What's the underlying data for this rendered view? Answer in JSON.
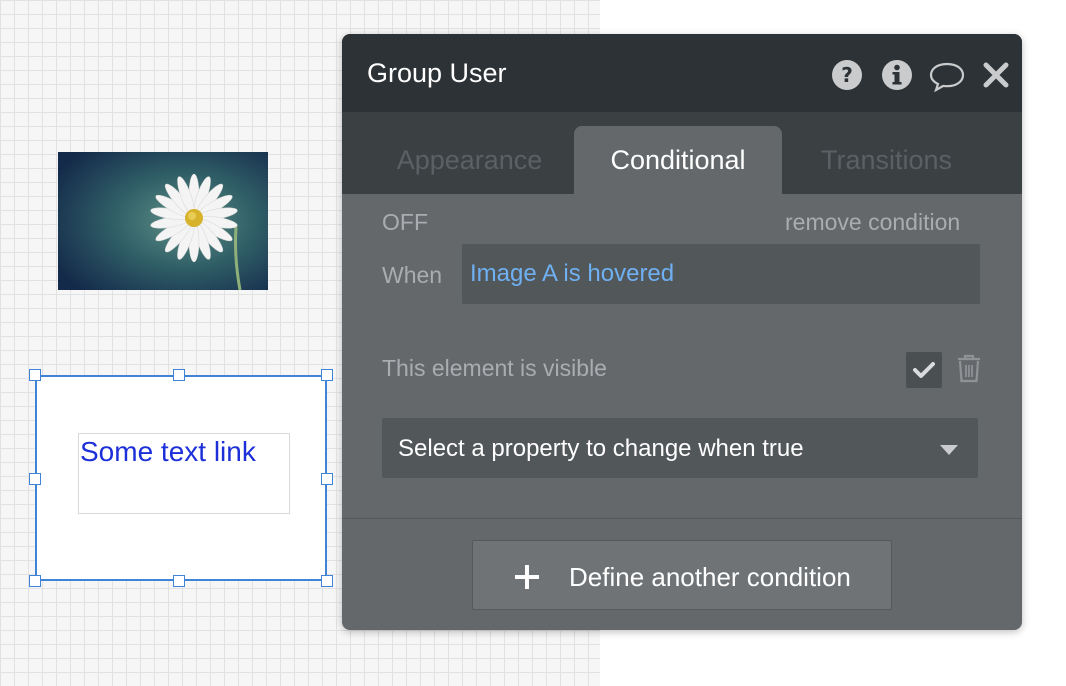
{
  "panel": {
    "title": "Group User",
    "icons": [
      "help-icon",
      "info-icon",
      "comment-icon",
      "close-icon"
    ]
  },
  "tabs": [
    {
      "label": "Appearance",
      "active": false
    },
    {
      "label": "Conditional",
      "active": true
    },
    {
      "label": "Transitions",
      "active": false
    }
  ],
  "condition": {
    "status": "OFF",
    "remove_label": "remove condition",
    "when_label": "When",
    "when_value": "Image A is hovered",
    "property_label": "This element is visible",
    "property_checked": true,
    "select_placeholder": "Select a property to change when true"
  },
  "define_button": {
    "label": "Define another condition"
  },
  "canvas": {
    "link_text": "Some text link"
  },
  "colors": {
    "panel_bg": "#64686b",
    "header_bg": "#2c3236",
    "link": "#1c2fd9",
    "condition_text": "#6fb0f2",
    "selection": "#3f84d6"
  }
}
